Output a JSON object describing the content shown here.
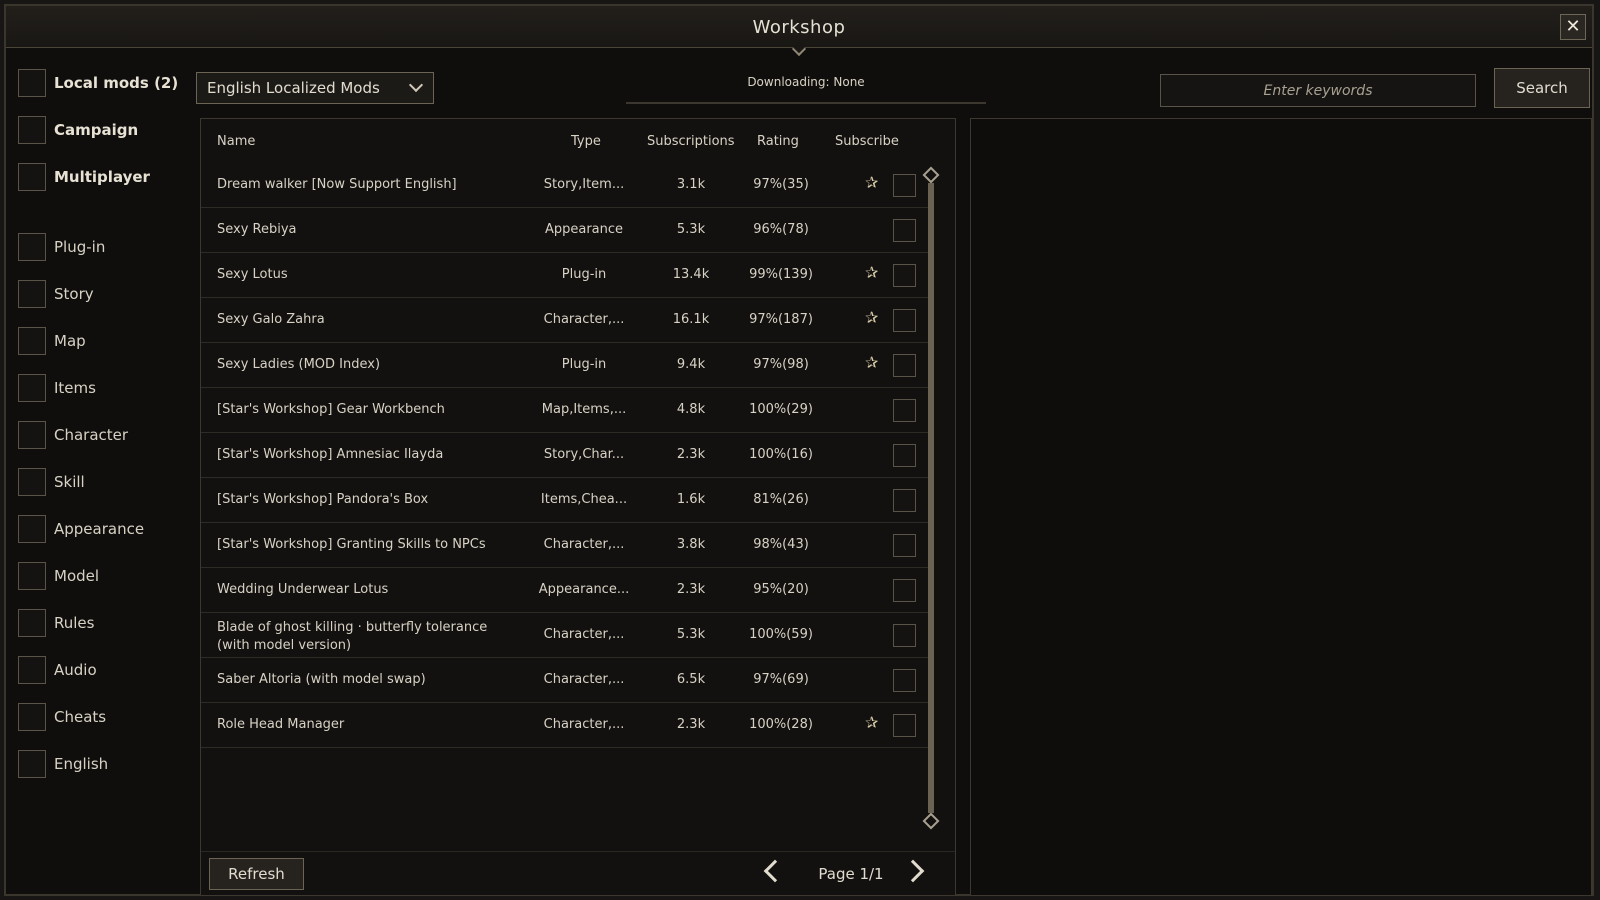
{
  "window": {
    "title": "Workshop",
    "close_label": "✕"
  },
  "sidebar": {
    "primary": [
      {
        "label": "Local mods (2)"
      },
      {
        "label": "Campaign"
      },
      {
        "label": "Multiplayer"
      }
    ],
    "categories": [
      {
        "label": "Plug-in"
      },
      {
        "label": "Story"
      },
      {
        "label": "Map"
      },
      {
        "label": "Items"
      },
      {
        "label": "Character"
      },
      {
        "label": "Skill"
      },
      {
        "label": "Appearance"
      },
      {
        "label": "Model"
      },
      {
        "label": "Rules"
      },
      {
        "label": "Audio"
      },
      {
        "label": "Cheats"
      },
      {
        "label": "English"
      }
    ]
  },
  "filter": {
    "selected": "English Localized Mods"
  },
  "status": {
    "downloading": "Downloading: None"
  },
  "search": {
    "placeholder": "Enter keywords",
    "button_label": "Search"
  },
  "table": {
    "columns": {
      "name": "Name",
      "type": "Type",
      "subscriptions": "Subscriptions",
      "rating": "Rating",
      "subscribe": "Subscribe"
    },
    "rows": [
      {
        "name": "Dream walker [Now Support English]",
        "type": "Story,Item...",
        "subs": "3.1k",
        "rating": "97%(35)",
        "star": "✰"
      },
      {
        "name": "Sexy Rebiya",
        "type": "Appearance",
        "subs": "5.3k",
        "rating": "96%(78)",
        "star": ""
      },
      {
        "name": "Sexy Lotus",
        "type": "Plug-in",
        "subs": "13.4k",
        "rating": "99%(139)",
        "star": "✰"
      },
      {
        "name": "Sexy Galo Zahra",
        "type": "Character,...",
        "subs": "16.1k",
        "rating": "97%(187)",
        "star": "✰"
      },
      {
        "name": "Sexy Ladies (MOD Index)",
        "type": "Plug-in",
        "subs": "9.4k",
        "rating": "97%(98)",
        "star": "✰"
      },
      {
        "name": "[Star's Workshop] Gear Workbench",
        "type": "Map,Items,...",
        "subs": "4.8k",
        "rating": "100%(29)",
        "star": ""
      },
      {
        "name": "[Star's Workshop] Amnesiac Ilayda",
        "type": "Story,Char...",
        "subs": "2.3k",
        "rating": "100%(16)",
        "star": ""
      },
      {
        "name": "[Star's Workshop] Pandora's Box",
        "type": "Items,Chea...",
        "subs": "1.6k",
        "rating": "81%(26)",
        "star": ""
      },
      {
        "name": "[Star's Workshop] Granting Skills to NPCs",
        "type": "Character,...",
        "subs": "3.8k",
        "rating": "98%(43)",
        "star": ""
      },
      {
        "name": "Wedding Underwear Lotus",
        "type": "Appearance...",
        "subs": "2.3k",
        "rating": "95%(20)",
        "star": ""
      },
      {
        "name": "Blade of ghost killing · butterfly tolerance (with model version)",
        "type": "Character,...",
        "subs": "5.3k",
        "rating": "100%(59)",
        "star": ""
      },
      {
        "name": "Saber Altoria (with model swap)",
        "type": "Character,...",
        "subs": "6.5k",
        "rating": "97%(69)",
        "star": ""
      },
      {
        "name": "Role Head Manager",
        "type": "Character,...",
        "subs": "2.3k",
        "rating": "100%(28)",
        "star": "✰"
      }
    ]
  },
  "footer": {
    "refresh_label": "Refresh",
    "page_label": "Page 1/1"
  }
}
